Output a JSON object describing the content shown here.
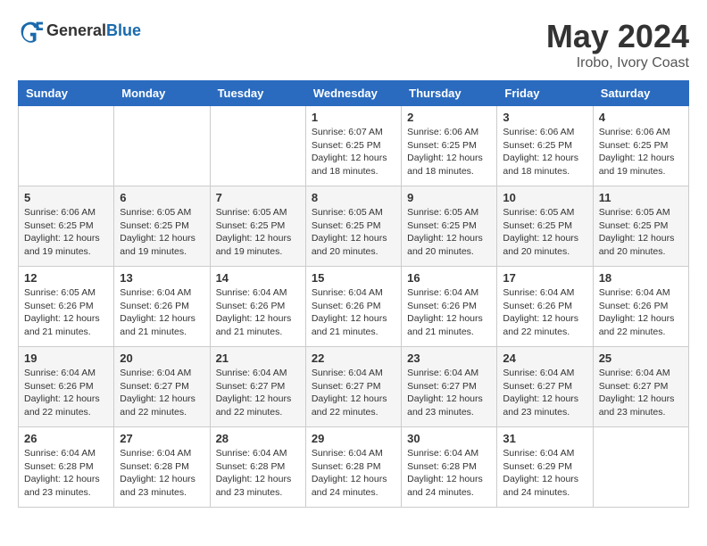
{
  "logo": {
    "general": "General",
    "blue": "Blue"
  },
  "header": {
    "month": "May 2024",
    "location": "Irobo, Ivory Coast"
  },
  "weekdays": [
    "Sunday",
    "Monday",
    "Tuesday",
    "Wednesday",
    "Thursday",
    "Friday",
    "Saturday"
  ],
  "weeks": [
    [
      {
        "day": "",
        "info": ""
      },
      {
        "day": "",
        "info": ""
      },
      {
        "day": "",
        "info": ""
      },
      {
        "day": "1",
        "info": "Sunrise: 6:07 AM\nSunset: 6:25 PM\nDaylight: 12 hours\nand 18 minutes."
      },
      {
        "day": "2",
        "info": "Sunrise: 6:06 AM\nSunset: 6:25 PM\nDaylight: 12 hours\nand 18 minutes."
      },
      {
        "day": "3",
        "info": "Sunrise: 6:06 AM\nSunset: 6:25 PM\nDaylight: 12 hours\nand 18 minutes."
      },
      {
        "day": "4",
        "info": "Sunrise: 6:06 AM\nSunset: 6:25 PM\nDaylight: 12 hours\nand 19 minutes."
      }
    ],
    [
      {
        "day": "5",
        "info": "Sunrise: 6:06 AM\nSunset: 6:25 PM\nDaylight: 12 hours\nand 19 minutes."
      },
      {
        "day": "6",
        "info": "Sunrise: 6:05 AM\nSunset: 6:25 PM\nDaylight: 12 hours\nand 19 minutes."
      },
      {
        "day": "7",
        "info": "Sunrise: 6:05 AM\nSunset: 6:25 PM\nDaylight: 12 hours\nand 19 minutes."
      },
      {
        "day": "8",
        "info": "Sunrise: 6:05 AM\nSunset: 6:25 PM\nDaylight: 12 hours\nand 20 minutes."
      },
      {
        "day": "9",
        "info": "Sunrise: 6:05 AM\nSunset: 6:25 PM\nDaylight: 12 hours\nand 20 minutes."
      },
      {
        "day": "10",
        "info": "Sunrise: 6:05 AM\nSunset: 6:25 PM\nDaylight: 12 hours\nand 20 minutes."
      },
      {
        "day": "11",
        "info": "Sunrise: 6:05 AM\nSunset: 6:25 PM\nDaylight: 12 hours\nand 20 minutes."
      }
    ],
    [
      {
        "day": "12",
        "info": "Sunrise: 6:05 AM\nSunset: 6:26 PM\nDaylight: 12 hours\nand 21 minutes."
      },
      {
        "day": "13",
        "info": "Sunrise: 6:04 AM\nSunset: 6:26 PM\nDaylight: 12 hours\nand 21 minutes."
      },
      {
        "day": "14",
        "info": "Sunrise: 6:04 AM\nSunset: 6:26 PM\nDaylight: 12 hours\nand 21 minutes."
      },
      {
        "day": "15",
        "info": "Sunrise: 6:04 AM\nSunset: 6:26 PM\nDaylight: 12 hours\nand 21 minutes."
      },
      {
        "day": "16",
        "info": "Sunrise: 6:04 AM\nSunset: 6:26 PM\nDaylight: 12 hours\nand 21 minutes."
      },
      {
        "day": "17",
        "info": "Sunrise: 6:04 AM\nSunset: 6:26 PM\nDaylight: 12 hours\nand 22 minutes."
      },
      {
        "day": "18",
        "info": "Sunrise: 6:04 AM\nSunset: 6:26 PM\nDaylight: 12 hours\nand 22 minutes."
      }
    ],
    [
      {
        "day": "19",
        "info": "Sunrise: 6:04 AM\nSunset: 6:26 PM\nDaylight: 12 hours\nand 22 minutes."
      },
      {
        "day": "20",
        "info": "Sunrise: 6:04 AM\nSunset: 6:27 PM\nDaylight: 12 hours\nand 22 minutes."
      },
      {
        "day": "21",
        "info": "Sunrise: 6:04 AM\nSunset: 6:27 PM\nDaylight: 12 hours\nand 22 minutes."
      },
      {
        "day": "22",
        "info": "Sunrise: 6:04 AM\nSunset: 6:27 PM\nDaylight: 12 hours\nand 22 minutes."
      },
      {
        "day": "23",
        "info": "Sunrise: 6:04 AM\nSunset: 6:27 PM\nDaylight: 12 hours\nand 23 minutes."
      },
      {
        "day": "24",
        "info": "Sunrise: 6:04 AM\nSunset: 6:27 PM\nDaylight: 12 hours\nand 23 minutes."
      },
      {
        "day": "25",
        "info": "Sunrise: 6:04 AM\nSunset: 6:27 PM\nDaylight: 12 hours\nand 23 minutes."
      }
    ],
    [
      {
        "day": "26",
        "info": "Sunrise: 6:04 AM\nSunset: 6:28 PM\nDaylight: 12 hours\nand 23 minutes."
      },
      {
        "day": "27",
        "info": "Sunrise: 6:04 AM\nSunset: 6:28 PM\nDaylight: 12 hours\nand 23 minutes."
      },
      {
        "day": "28",
        "info": "Sunrise: 6:04 AM\nSunset: 6:28 PM\nDaylight: 12 hours\nand 23 minutes."
      },
      {
        "day": "29",
        "info": "Sunrise: 6:04 AM\nSunset: 6:28 PM\nDaylight: 12 hours\nand 24 minutes."
      },
      {
        "day": "30",
        "info": "Sunrise: 6:04 AM\nSunset: 6:28 PM\nDaylight: 12 hours\nand 24 minutes."
      },
      {
        "day": "31",
        "info": "Sunrise: 6:04 AM\nSunset: 6:29 PM\nDaylight: 12 hours\nand 24 minutes."
      },
      {
        "day": "",
        "info": ""
      }
    ]
  ]
}
